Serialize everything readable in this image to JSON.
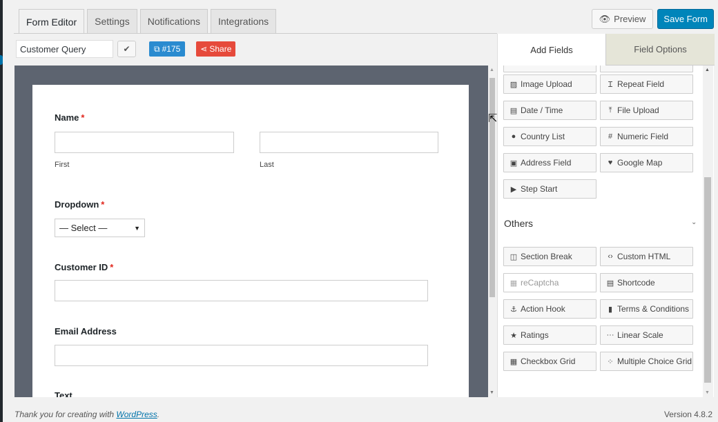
{
  "tabs": [
    "Form Editor",
    "Settings",
    "Notifications",
    "Integrations"
  ],
  "header": {
    "preview_label": "Preview",
    "save_label": "Save Form"
  },
  "form_bar": {
    "form_name": "Customer Query",
    "check_glyph": "✔",
    "id_badge": "#175",
    "share_label": "Share"
  },
  "form": {
    "name_label": "Name",
    "first_label": "First",
    "last_label": "Last",
    "dropdown_label": "Dropdown",
    "dropdown_value": "— Select —",
    "customer_id_label": "Customer ID",
    "email_label": "Email Address",
    "text_label": "Text",
    "required_mark": "*"
  },
  "panel": {
    "tab_add": "Add Fields",
    "tab_options": "Field Options",
    "fields": [
      {
        "label": "Image Upload",
        "icon": "image-icon"
      },
      {
        "label": "Repeat Field",
        "icon": "text-cursor-icon"
      },
      {
        "label": "Date / Time",
        "icon": "calendar-icon"
      },
      {
        "label": "File Upload",
        "icon": "upload-icon"
      },
      {
        "label": "Country List",
        "icon": "globe-icon"
      },
      {
        "label": "Numeric Field",
        "icon": "hash-icon"
      },
      {
        "label": "Address Field",
        "icon": "address-card-icon"
      },
      {
        "label": "Google Map",
        "icon": "map-pin-icon"
      },
      {
        "label": "Step Start",
        "icon": "step-icon"
      }
    ],
    "others_title": "Others",
    "others": [
      {
        "label": "Section Break",
        "icon": "columns-icon"
      },
      {
        "label": "Custom HTML",
        "icon": "code-icon"
      },
      {
        "label": "reCaptcha",
        "icon": "qrcode-icon",
        "disabled": true
      },
      {
        "label": "Shortcode",
        "icon": "calendar-icon"
      },
      {
        "label": "Action Hook",
        "icon": "anchor-icon"
      },
      {
        "label": "Terms & Conditions",
        "icon": "file-icon"
      },
      {
        "label": "Ratings",
        "icon": "star-icon"
      },
      {
        "label": "Linear Scale",
        "icon": "ellipsis-icon"
      },
      {
        "label": "Checkbox Grid",
        "icon": "grid-icon"
      },
      {
        "label": "Multiple Choice Grid",
        "icon": "dots-grid-icon"
      }
    ]
  },
  "footer": {
    "thanks_prefix": "Thank you for creating with ",
    "wp_link": "WordPress",
    "thanks_suffix": ".",
    "version": "Version 4.8.2"
  }
}
